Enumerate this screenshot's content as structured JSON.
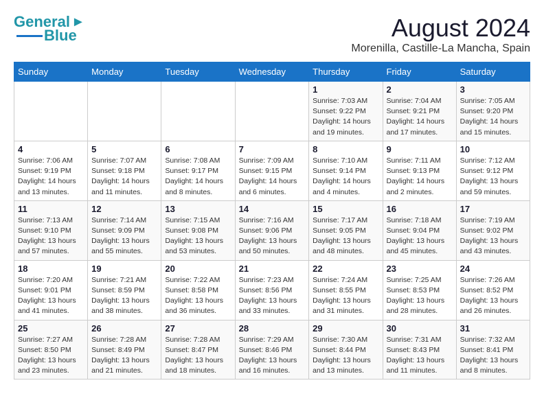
{
  "header": {
    "logo_line1": "General",
    "logo_line2": "Blue",
    "month_year": "August 2024",
    "location": "Morenilla, Castille-La Mancha, Spain"
  },
  "days_of_week": [
    "Sunday",
    "Monday",
    "Tuesday",
    "Wednesday",
    "Thursday",
    "Friday",
    "Saturday"
  ],
  "weeks": [
    [
      {
        "day": "",
        "info": ""
      },
      {
        "day": "",
        "info": ""
      },
      {
        "day": "",
        "info": ""
      },
      {
        "day": "",
        "info": ""
      },
      {
        "day": "1",
        "info": "Sunrise: 7:03 AM\nSunset: 9:22 PM\nDaylight: 14 hours\nand 19 minutes."
      },
      {
        "day": "2",
        "info": "Sunrise: 7:04 AM\nSunset: 9:21 PM\nDaylight: 14 hours\nand 17 minutes."
      },
      {
        "day": "3",
        "info": "Sunrise: 7:05 AM\nSunset: 9:20 PM\nDaylight: 14 hours\nand 15 minutes."
      }
    ],
    [
      {
        "day": "4",
        "info": "Sunrise: 7:06 AM\nSunset: 9:19 PM\nDaylight: 14 hours\nand 13 minutes."
      },
      {
        "day": "5",
        "info": "Sunrise: 7:07 AM\nSunset: 9:18 PM\nDaylight: 14 hours\nand 11 minutes."
      },
      {
        "day": "6",
        "info": "Sunrise: 7:08 AM\nSunset: 9:17 PM\nDaylight: 14 hours\nand 8 minutes."
      },
      {
        "day": "7",
        "info": "Sunrise: 7:09 AM\nSunset: 9:15 PM\nDaylight: 14 hours\nand 6 minutes."
      },
      {
        "day": "8",
        "info": "Sunrise: 7:10 AM\nSunset: 9:14 PM\nDaylight: 14 hours\nand 4 minutes."
      },
      {
        "day": "9",
        "info": "Sunrise: 7:11 AM\nSunset: 9:13 PM\nDaylight: 14 hours\nand 2 minutes."
      },
      {
        "day": "10",
        "info": "Sunrise: 7:12 AM\nSunset: 9:12 PM\nDaylight: 13 hours\nand 59 minutes."
      }
    ],
    [
      {
        "day": "11",
        "info": "Sunrise: 7:13 AM\nSunset: 9:10 PM\nDaylight: 13 hours\nand 57 minutes."
      },
      {
        "day": "12",
        "info": "Sunrise: 7:14 AM\nSunset: 9:09 PM\nDaylight: 13 hours\nand 55 minutes."
      },
      {
        "day": "13",
        "info": "Sunrise: 7:15 AM\nSunset: 9:08 PM\nDaylight: 13 hours\nand 53 minutes."
      },
      {
        "day": "14",
        "info": "Sunrise: 7:16 AM\nSunset: 9:06 PM\nDaylight: 13 hours\nand 50 minutes."
      },
      {
        "day": "15",
        "info": "Sunrise: 7:17 AM\nSunset: 9:05 PM\nDaylight: 13 hours\nand 48 minutes."
      },
      {
        "day": "16",
        "info": "Sunrise: 7:18 AM\nSunset: 9:04 PM\nDaylight: 13 hours\nand 45 minutes."
      },
      {
        "day": "17",
        "info": "Sunrise: 7:19 AM\nSunset: 9:02 PM\nDaylight: 13 hours\nand 43 minutes."
      }
    ],
    [
      {
        "day": "18",
        "info": "Sunrise: 7:20 AM\nSunset: 9:01 PM\nDaylight: 13 hours\nand 41 minutes."
      },
      {
        "day": "19",
        "info": "Sunrise: 7:21 AM\nSunset: 8:59 PM\nDaylight: 13 hours\nand 38 minutes."
      },
      {
        "day": "20",
        "info": "Sunrise: 7:22 AM\nSunset: 8:58 PM\nDaylight: 13 hours\nand 36 minutes."
      },
      {
        "day": "21",
        "info": "Sunrise: 7:23 AM\nSunset: 8:56 PM\nDaylight: 13 hours\nand 33 minutes."
      },
      {
        "day": "22",
        "info": "Sunrise: 7:24 AM\nSunset: 8:55 PM\nDaylight: 13 hours\nand 31 minutes."
      },
      {
        "day": "23",
        "info": "Sunrise: 7:25 AM\nSunset: 8:53 PM\nDaylight: 13 hours\nand 28 minutes."
      },
      {
        "day": "24",
        "info": "Sunrise: 7:26 AM\nSunset: 8:52 PM\nDaylight: 13 hours\nand 26 minutes."
      }
    ],
    [
      {
        "day": "25",
        "info": "Sunrise: 7:27 AM\nSunset: 8:50 PM\nDaylight: 13 hours\nand 23 minutes."
      },
      {
        "day": "26",
        "info": "Sunrise: 7:28 AM\nSunset: 8:49 PM\nDaylight: 13 hours\nand 21 minutes."
      },
      {
        "day": "27",
        "info": "Sunrise: 7:28 AM\nSunset: 8:47 PM\nDaylight: 13 hours\nand 18 minutes."
      },
      {
        "day": "28",
        "info": "Sunrise: 7:29 AM\nSunset: 8:46 PM\nDaylight: 13 hours\nand 16 minutes."
      },
      {
        "day": "29",
        "info": "Sunrise: 7:30 AM\nSunset: 8:44 PM\nDaylight: 13 hours\nand 13 minutes."
      },
      {
        "day": "30",
        "info": "Sunrise: 7:31 AM\nSunset: 8:43 PM\nDaylight: 13 hours\nand 11 minutes."
      },
      {
        "day": "31",
        "info": "Sunrise: 7:32 AM\nSunset: 8:41 PM\nDaylight: 13 hours\nand 8 minutes."
      }
    ]
  ]
}
